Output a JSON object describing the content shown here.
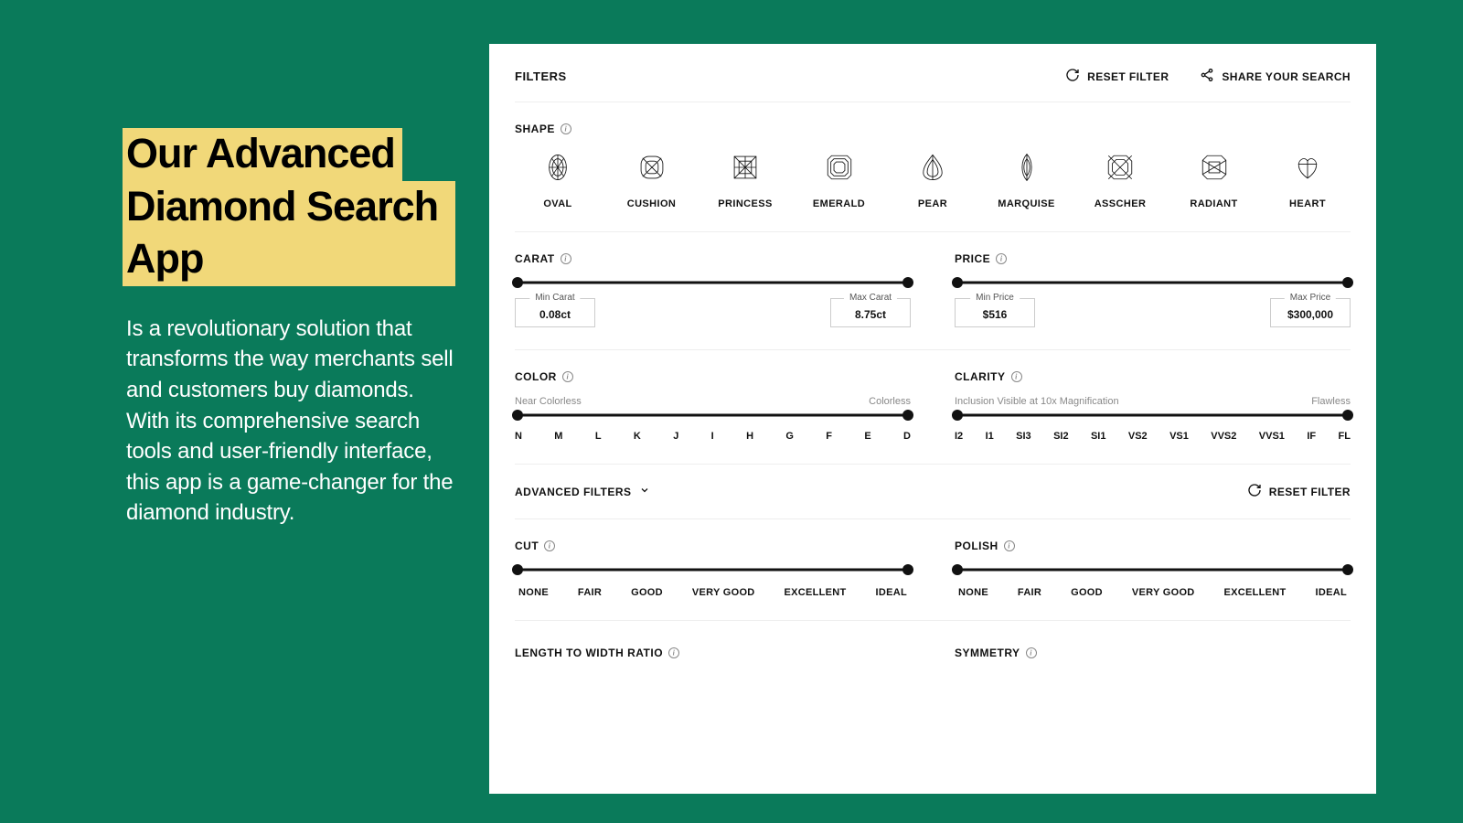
{
  "promo": {
    "title_line1": "Our Advanced",
    "title_line2": "Diamond Search App",
    "body": "Is a revolutionary solution that transforms the way merchants sell and customers buy diamonds. With its comprehensive search tools and user-friendly interface, this app is a game-changer for the diamond industry."
  },
  "header": {
    "filters_label": "FILTERS",
    "reset_label": "RESET FILTER",
    "share_label": "SHARE YOUR SEARCH"
  },
  "shape": {
    "title": "SHAPE",
    "items": [
      {
        "label": "OVAL"
      },
      {
        "label": "CUSHION"
      },
      {
        "label": "PRINCESS"
      },
      {
        "label": "EMERALD"
      },
      {
        "label": "PEAR"
      },
      {
        "label": "MARQUISE"
      },
      {
        "label": "ASSCHER"
      },
      {
        "label": "RADIANT"
      },
      {
        "label": "HEART"
      }
    ]
  },
  "carat": {
    "title": "CARAT",
    "min_label": "Min Carat",
    "min_value": "0.08ct",
    "max_label": "Max Carat",
    "max_value": "8.75ct"
  },
  "price": {
    "title": "PRICE",
    "min_label": "Min Price",
    "min_value": "$516",
    "max_label": "Max Price",
    "max_value": "$300,000"
  },
  "color": {
    "title": "COLOR",
    "hint_left": "Near Colorless",
    "hint_right": "Colorless",
    "ticks": [
      "N",
      "M",
      "L",
      "K",
      "J",
      "I",
      "H",
      "G",
      "F",
      "E",
      "D"
    ]
  },
  "clarity": {
    "title": "CLARITY",
    "hint_left": "Inclusion Visible at 10x Magnification",
    "hint_right": "Flawless",
    "ticks": [
      "I2",
      "I1",
      "SI3",
      "SI2",
      "SI1",
      "VS2",
      "VS1",
      "VVS2",
      "VVS1",
      "IF",
      "FL"
    ]
  },
  "advanced": {
    "title": "ADVANCED FILTERS",
    "reset_label": "RESET FILTER"
  },
  "cut": {
    "title": "CUT",
    "ticks": [
      "NONE",
      "FAIR",
      "GOOD",
      "VERY GOOD",
      "EXCELLENT",
      "IDEAL"
    ]
  },
  "polish": {
    "title": "POLISH",
    "ticks": [
      "NONE",
      "FAIR",
      "GOOD",
      "VERY GOOD",
      "EXCELLENT",
      "IDEAL"
    ]
  },
  "ltw": {
    "title": "LENGTH TO WIDTH RATIO"
  },
  "symmetry": {
    "title": "SYMMETRY"
  }
}
